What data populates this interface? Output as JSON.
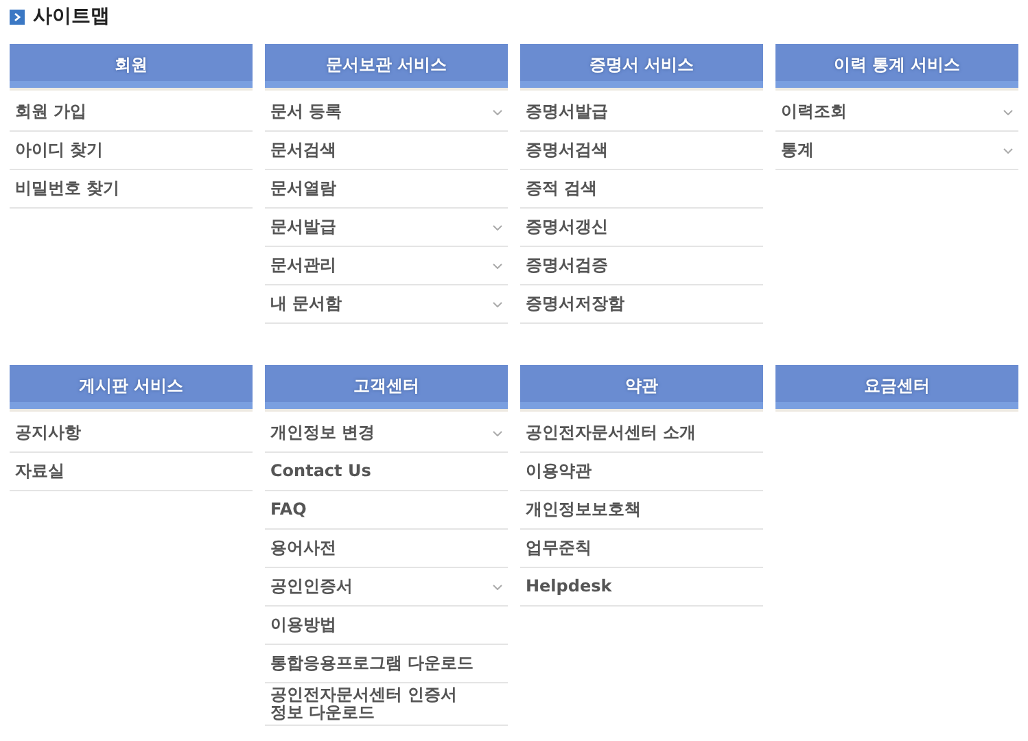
{
  "title": "사이트맵",
  "groups": [
    {
      "sections": [
        {
          "heading": "회원",
          "items": [
            {
              "label": "회원 가입",
              "expandable": false
            },
            {
              "label": "아이디 찾기",
              "expandable": false
            },
            {
              "label": "비밀번호 찾기",
              "expandable": false
            }
          ]
        },
        {
          "heading": "문서보관 서비스",
          "items": [
            {
              "label": "문서 등록",
              "expandable": true
            },
            {
              "label": "문서검색",
              "expandable": false
            },
            {
              "label": "문서열람",
              "expandable": false
            },
            {
              "label": "문서발급",
              "expandable": true
            },
            {
              "label": "문서관리",
              "expandable": true
            },
            {
              "label": "내 문서함",
              "expandable": true
            }
          ]
        },
        {
          "heading": "증명서 서비스",
          "items": [
            {
              "label": "증명서발급",
              "expandable": false
            },
            {
              "label": "증명서검색",
              "expandable": false
            },
            {
              "label": "증적 검색",
              "expandable": false
            },
            {
              "label": "증명서갱신",
              "expandable": false
            },
            {
              "label": "증명서검증",
              "expandable": false
            },
            {
              "label": "증명서저장함",
              "expandable": false
            }
          ]
        },
        {
          "heading": "이력 통계 서비스",
          "items": [
            {
              "label": "이력조회",
              "expandable": true
            },
            {
              "label": "통계",
              "expandable": true
            }
          ]
        }
      ]
    },
    {
      "sections": [
        {
          "heading": "게시판 서비스",
          "items": [
            {
              "label": "공지사항",
              "expandable": false
            },
            {
              "label": "자료실",
              "expandable": false
            }
          ]
        },
        {
          "heading": "고객센터",
          "items": [
            {
              "label": "개인정보 변경",
              "expandable": true
            },
            {
              "label": "Contact Us",
              "expandable": false
            },
            {
              "label": "FAQ",
              "expandable": false
            },
            {
              "label": "용어사전",
              "expandable": false
            },
            {
              "label": "공인인증서",
              "expandable": true
            },
            {
              "label": "이용방법",
              "expandable": false
            },
            {
              "label": "통합응용프로그램 다운로드",
              "expandable": false
            },
            {
              "label": "공인전자문서센터 인증서 정보 다운로드",
              "expandable": false
            }
          ]
        },
        {
          "heading": "약관",
          "items": [
            {
              "label": "공인전자문서센터 소개",
              "expandable": false
            },
            {
              "label": "이용약관",
              "expandable": false
            },
            {
              "label": "개인정보보호책",
              "expandable": false
            },
            {
              "label": "업무준칙",
              "expandable": false
            },
            {
              "label": "Helpdesk",
              "expandable": false
            }
          ]
        },
        {
          "heading": "요금센터"
        }
      ]
    }
  ]
}
